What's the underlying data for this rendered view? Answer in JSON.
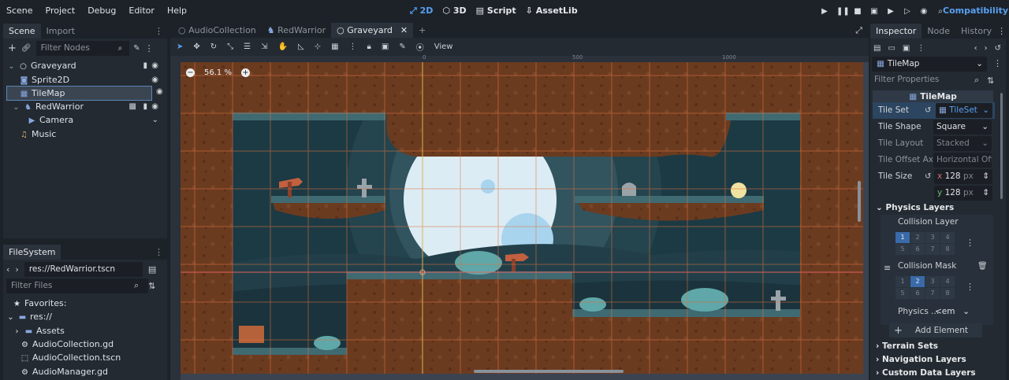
{
  "menu": [
    "Scene",
    "Project",
    "Debug",
    "Editor",
    "Help"
  ],
  "modes": [
    {
      "label": "⤢ 2D",
      "active": true
    },
    {
      "label": "3D",
      "active": false
    },
    {
      "label": "Script",
      "active": false
    },
    {
      "label": "AssetLib",
      "active": false
    }
  ],
  "compat": "Compatibility",
  "scene_panel": {
    "tabs": [
      "Scene",
      "Import"
    ],
    "filter_placeholder": "Filter Nodes",
    "nodes": [
      "Graveyard",
      "Sprite2D",
      "TileMap",
      "RedWarrior",
      "Camera",
      "Music"
    ]
  },
  "filesystem": {
    "tab": "FileSystem",
    "path": "res://RedWarrior.tscn",
    "filter_placeholder": "Filter Files",
    "items": [
      "Favorites:",
      "res://",
      "Assets",
      "AudioCollection.gd",
      "AudioCollection.tscn",
      "AudioManager.gd"
    ]
  },
  "editor_tabs": [
    "AudioCollection",
    "RedWarrior",
    "Graveyard"
  ],
  "toolbar": {
    "view": "View"
  },
  "zoom": "56.1 %",
  "ruler": [
    "-500",
    "0",
    "500",
    "1000",
    "1500"
  ],
  "inspector": {
    "tabs": [
      "Inspector",
      "Node",
      "History"
    ],
    "object": "TileMap",
    "filter_placeholder": "Filter Properties",
    "header": "TileMap",
    "tile_set_label": "Tile Set",
    "tile_set_value": "TileSet",
    "tile_shape_label": "Tile Shape",
    "tile_shape_value": "Square",
    "tile_layout_label": "Tile Layout",
    "tile_layout_value": "Stacked",
    "tile_offset_label": "Tile Offset Axis",
    "tile_offset_value": "Horizontal Offs",
    "tile_size_label": "Tile Size",
    "tile_size_x": "128",
    "tile_size_y": "128",
    "unit": "px",
    "x": "x",
    "y": "y",
    "physics_layers": "Physics Layers",
    "collision_layer": "Collision Layer",
    "collision_mask": "Collision Mask",
    "layer_numbers": [
      "1",
      "2",
      "3",
      "4",
      "5",
      "6",
      "7",
      "8"
    ],
    "physics_mat_label": "Physics ...",
    "physics_mat_value": "<em",
    "add_element": "Add Element",
    "terrain_sets": "Terrain Sets",
    "navigation_layers": "Navigation Layers",
    "custom_data_layers": "Custom Data Layers"
  }
}
